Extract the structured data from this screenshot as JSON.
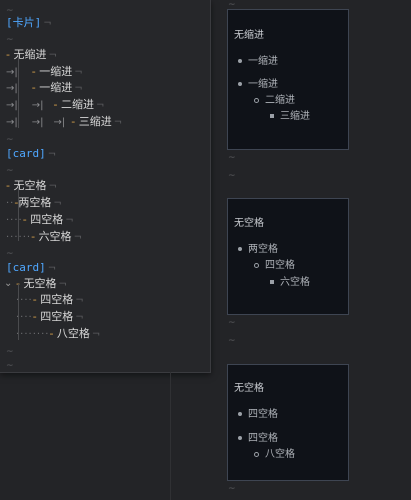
{
  "editor": {
    "tilde": "~",
    "newline": "¬",
    "dash": "-",
    "tab": "→|",
    "card1": {
      "tag": "[卡片]",
      "items": [
        "无缩进",
        "一缩进",
        "一缩进",
        "二缩进",
        "三缩进"
      ]
    },
    "card2": {
      "tag": "[card]",
      "items": [
        "无空格",
        "两空格",
        "四空格",
        "六空格"
      ]
    },
    "card3": {
      "tag": "[card]",
      "items": [
        "无空格",
        "四空格",
        "四空格",
        "八空格"
      ]
    }
  },
  "preview": {
    "tilde": "~",
    "card1": {
      "title": "无缩进",
      "items": [
        "一缩进",
        "一缩进",
        "二缩进",
        "三缩进"
      ]
    },
    "card2": {
      "title": "无空格",
      "items": [
        "两空格",
        "四空格",
        "六空格"
      ]
    },
    "card3": {
      "title": "无空格",
      "items": [
        "四空格",
        "四空格",
        "八空格"
      ]
    }
  }
}
